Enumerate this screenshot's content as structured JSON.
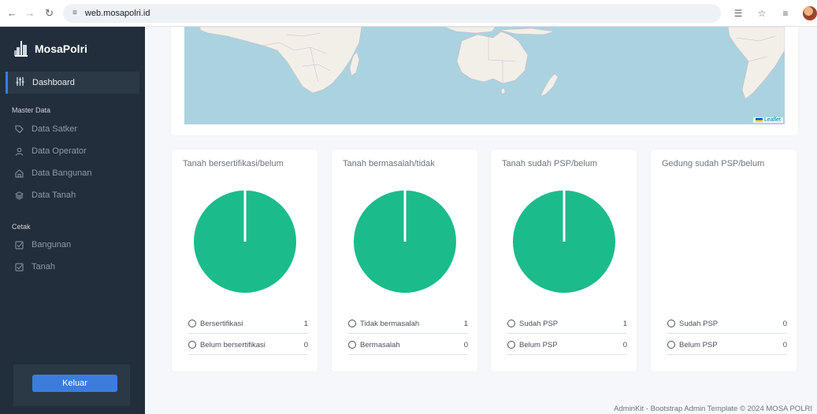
{
  "browser": {
    "url": "web.mosapolri.id"
  },
  "sidebar": {
    "brand": "MosaPolri",
    "active_item": "Dashboard",
    "sections": [
      {
        "heading": "Master Data",
        "items": [
          "Data Satker",
          "Data Operator",
          "Data Bangunan",
          "Data Tanah"
        ]
      },
      {
        "heading": "Cetak",
        "items": [
          "Bangunan",
          "Tanah"
        ]
      }
    ],
    "logout_label": "Keluar"
  },
  "map": {
    "attribution": "Leaflet"
  },
  "cards": [
    {
      "title": "Tanah bersertifikasi/belum",
      "legend": [
        {
          "label": "Bersertifikasi",
          "value": "1",
          "color": "#1cbb8c"
        },
        {
          "label": "Belum bersertifikasi",
          "value": "0",
          "color": "#dc3545"
        }
      ]
    },
    {
      "title": "Tanah bermasalah/tidak",
      "legend": [
        {
          "label": "Tidak bermasalah",
          "value": "1",
          "color": "#1cbb8c"
        },
        {
          "label": "Bermasalah",
          "value": "0",
          "color": "#dc3545"
        }
      ]
    },
    {
      "title": "Tanah sudah PSP/belum",
      "legend": [
        {
          "label": "Sudah PSP",
          "value": "1",
          "color": "#1cbb8c"
        },
        {
          "label": "Belum PSP",
          "value": "0",
          "color": "#dc3545"
        }
      ]
    },
    {
      "title": "Gedung sudah PSP/belum",
      "legend": [
        {
          "label": "Sudah PSP",
          "value": "0",
          "color": "#1cbb8c"
        },
        {
          "label": "Belum PSP",
          "value": "0",
          "color": "#dc3545"
        }
      ]
    }
  ],
  "chart_data": [
    {
      "type": "pie",
      "labels": [
        "Bersertifikasi",
        "Belum bersertifikasi"
      ],
      "values": [
        1,
        0
      ],
      "colors": [
        "#1cbb8c",
        "#dc3545"
      ]
    },
    {
      "type": "pie",
      "labels": [
        "Tidak bermasalah",
        "Bermasalah"
      ],
      "values": [
        1,
        0
      ],
      "colors": [
        "#1cbb8c",
        "#dc3545"
      ]
    },
    {
      "type": "pie",
      "labels": [
        "Sudah PSP",
        "Belum PSP"
      ],
      "values": [
        1,
        0
      ],
      "colors": [
        "#1cbb8c",
        "#dc3545"
      ]
    },
    {
      "type": "pie",
      "labels": [
        "Sudah PSP",
        "Belum PSP"
      ],
      "values": [
        0,
        0
      ],
      "colors": [
        "#1cbb8c",
        "#dc3545"
      ]
    }
  ],
  "footer": {
    "text": "AdminKit - Bootstrap Admin Template © 2024 MOSA POLRI"
  }
}
